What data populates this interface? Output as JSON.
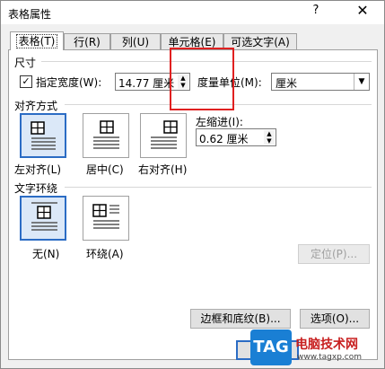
{
  "window": {
    "title": "表格属性",
    "help_glyph": "?",
    "close_glyph": "✕"
  },
  "tabs": [
    {
      "label": "表格(T)",
      "active": true
    },
    {
      "label": "行(R)"
    },
    {
      "label": "列(U)"
    },
    {
      "label": "单元格(E)"
    },
    {
      "label": "可选文字(A)"
    }
  ],
  "size": {
    "heading": "尺寸",
    "preferred_width_checked": true,
    "preferred_width_label": "指定宽度(W):",
    "preferred_width_value": "14.77 厘米",
    "unit_label": "度量单位(M):",
    "unit_value": "厘米"
  },
  "alignment": {
    "heading": "对齐方式",
    "options": [
      {
        "label": "左对齐(L)",
        "selected": true
      },
      {
        "label": "居中(C)"
      },
      {
        "label": "右对齐(H)"
      }
    ],
    "indent_label": "左缩进(I):",
    "indent_value": "0.62 厘米"
  },
  "wrapping": {
    "heading": "文字环绕",
    "options": [
      {
        "label": "无(N)",
        "selected": true
      },
      {
        "label": "环绕(A)"
      }
    ],
    "position_button": "定位(P)..."
  },
  "buttons": {
    "borders": "边框和底纹(B)...",
    "options": "选项(O)..."
  },
  "watermark": {
    "tag": "TAG",
    "line1": "电脑技术网",
    "line2": "www.tagxp.com"
  },
  "colors": {
    "accent": "#2b6cc4",
    "highlight": "#e02020"
  }
}
